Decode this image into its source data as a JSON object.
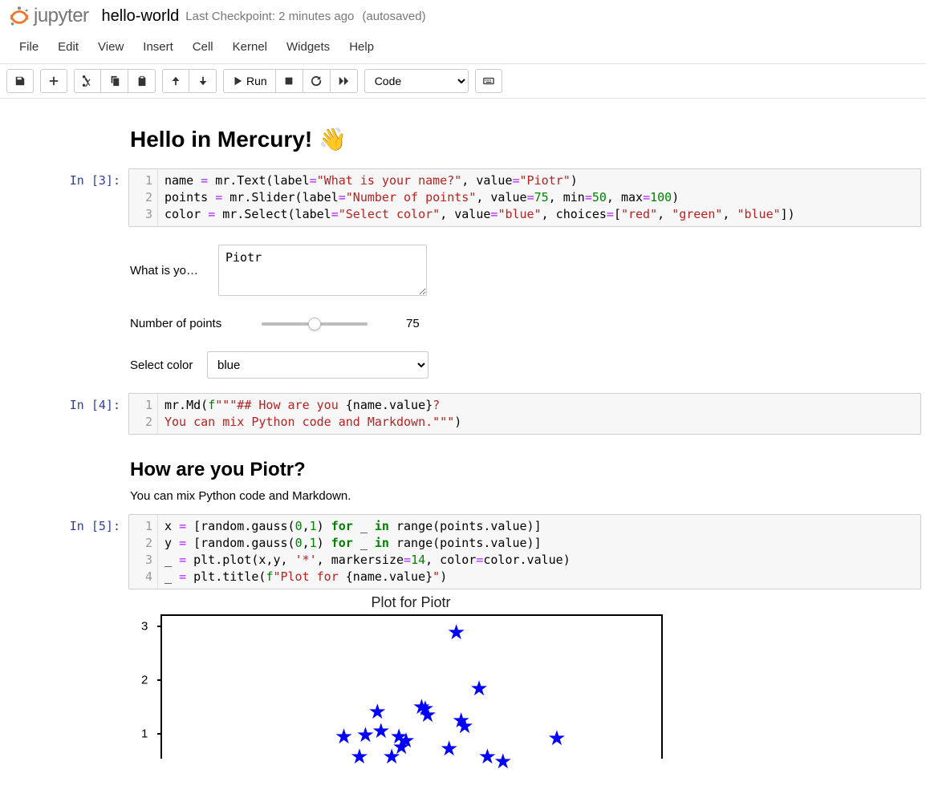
{
  "header": {
    "logo_text": "jupyter",
    "notebook_name": "hello-world",
    "checkpoint": "Last Checkpoint: 2 minutes ago",
    "autosaved": "(autosaved)"
  },
  "menu": [
    "File",
    "Edit",
    "View",
    "Insert",
    "Cell",
    "Kernel",
    "Widgets",
    "Help"
  ],
  "toolbar": {
    "run_label": "Run",
    "cell_type": "Code"
  },
  "cells": {
    "markdown_title": "Hello in Mercury! 👋",
    "c3": {
      "prompt": "In [3]:",
      "lines": [
        "1",
        "2",
        "3"
      ],
      "l1": {
        "a": "name ",
        "op": "=",
        "b": " mr.Text(label",
        "c": "=",
        "s1": "\"What is your name?\"",
        "d": ", value",
        "e": "=",
        "s2": "\"Piotr\"",
        "f": ")"
      },
      "l2": {
        "a": "points ",
        "op": "=",
        "b": " mr.Slider(label",
        "c": "=",
        "s1": "\"Number of points\"",
        "d": ", value",
        "e": "=",
        "n1": "75",
        "f": ", min",
        "g": "=",
        "n2": "50",
        "h": ", max",
        "i": "=",
        "n3": "100",
        "j": ")"
      },
      "l3": {
        "a": "color ",
        "op": "=",
        "b": " mr.Select(label",
        "c": "=",
        "s1": "\"Select color\"",
        "d": ", value",
        "e": "=",
        "s2": "\"blue\"",
        "f": ", choices",
        "g": "=",
        "h": "[",
        "s3": "\"red\"",
        "i": ", ",
        "s4": "\"green\"",
        "j": ", ",
        "s5": "\"blue\"",
        "k": "])"
      }
    },
    "widgets": {
      "name_label": "What is yo…",
      "name_value": "Piotr",
      "points_label": "Number of points",
      "points_value": "75",
      "points_min": 50,
      "points_max": 100,
      "color_label": "Select color",
      "color_value": "blue",
      "color_options": [
        "red",
        "green",
        "blue"
      ]
    },
    "c4": {
      "prompt": "In [4]:",
      "lines": [
        "1",
        "2"
      ],
      "l1": {
        "a": "mr.Md(",
        "fpre": "f",
        "s1": "\"\"\"## How are you ",
        "b": "{name.value}",
        "q": "?"
      },
      "l2": {
        "s1": "You can mix Python code and Markdown.\"\"\"",
        "a": ")"
      }
    },
    "md_out": {
      "h2": "How are you Piotr?",
      "p": "You can mix Python code and Markdown."
    },
    "c5": {
      "prompt": "In [5]:",
      "lines": [
        "1",
        "2",
        "3",
        "4"
      ],
      "l1": {
        "a": "x ",
        "op": "=",
        "b": " [random.gauss(",
        "n1": "0",
        "c": ",",
        "n2": "1",
        "d": ") ",
        "k1": "for",
        "e": " _ ",
        "k2": "in",
        "f": " range(points.value)]"
      },
      "l2": {
        "a": "y ",
        "op": "=",
        "b": " [random.gauss(",
        "n1": "0",
        "c": ",",
        "n2": "1",
        "d": ") ",
        "k1": "for",
        "e": " _ ",
        "k2": "in",
        "f": " range(points.value)]"
      },
      "l3": {
        "a": "_ ",
        "op": "=",
        "b": " plt.plot(x,y, ",
        "s1": "'*'",
        "c": ", markersize",
        "d": "=",
        "n1": "14",
        "e": ", color",
        "f": "=",
        "g": "color.value)"
      },
      "l4": {
        "a": "_ ",
        "op": "=",
        "b": " plt.title(",
        "fpre": "f",
        "s1": "\"Plot for ",
        "c": "{name.value}",
        "s2": "\"",
        "d": ")"
      }
    }
  },
  "chart_data": {
    "type": "scatter",
    "title": "Plot for Piotr",
    "xlabel": "",
    "ylabel": "",
    "ylim": [
      0.5,
      3.2
    ],
    "yticks": [
      1,
      2,
      3
    ],
    "marker": "*",
    "marker_color": "#0000ff",
    "markersize": 14,
    "n_points_total": 75,
    "note": "Only the top portion of the chart is visible in the screenshot; points below are approximate readings of visible markers.",
    "points": [
      {
        "x": 0.36,
        "y": 2.9
      },
      {
        "x": 0.55,
        "y": 1.85
      },
      {
        "x": 0.07,
        "y": 1.5
      },
      {
        "x": 0.1,
        "y": 1.48
      },
      {
        "x": 0.12,
        "y": 1.35
      },
      {
        "x": 0.4,
        "y": 1.25
      },
      {
        "x": 0.43,
        "y": 1.15
      },
      {
        "x": -0.3,
        "y": 1.42
      },
      {
        "x": -0.27,
        "y": 1.06
      },
      {
        "x": -0.12,
        "y": 0.95
      },
      {
        "x": -0.06,
        "y": 0.87
      },
      {
        "x": -0.4,
        "y": 0.98
      },
      {
        "x": -0.58,
        "y": 0.95
      },
      {
        "x": -0.1,
        "y": 0.75
      },
      {
        "x": -0.18,
        "y": 0.58
      },
      {
        "x": -0.45,
        "y": 0.58
      },
      {
        "x": 0.3,
        "y": 0.72
      },
      {
        "x": 0.75,
        "y": 0.48
      },
      {
        "x": 1.2,
        "y": 0.92
      },
      {
        "x": 0.62,
        "y": 0.58
      }
    ]
  }
}
